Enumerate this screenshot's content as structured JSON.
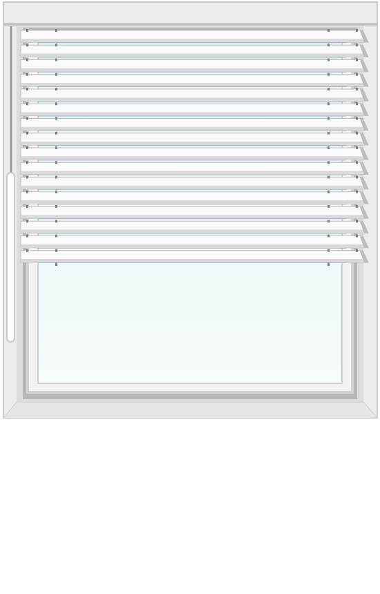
{
  "scene": {
    "subject": "window-with-venetian-blind",
    "slat_count": 16,
    "blind_open_fraction": 0.58,
    "cord": "left-side-wand",
    "colors": {
      "frame": "#ececec",
      "frame_edge": "#c8c8c8",
      "frame_inner_shadow": "#b5b5b5",
      "sash": "#d3d3d3",
      "sill": "#e6e6e6",
      "glass_top": "#dff2f5",
      "glass_bottom": "#f7fbfc",
      "slat_face": "#fafafa",
      "slat_shade": "#d9d9d9",
      "slat_edge": "#bdbdbd",
      "gap_teal": "#8fb7bd",
      "ladder_tape": "#7d7d7d",
      "wand": "#ffffff",
      "wand_outline": "#c9c9c9",
      "headrail": "#ededed"
    }
  }
}
